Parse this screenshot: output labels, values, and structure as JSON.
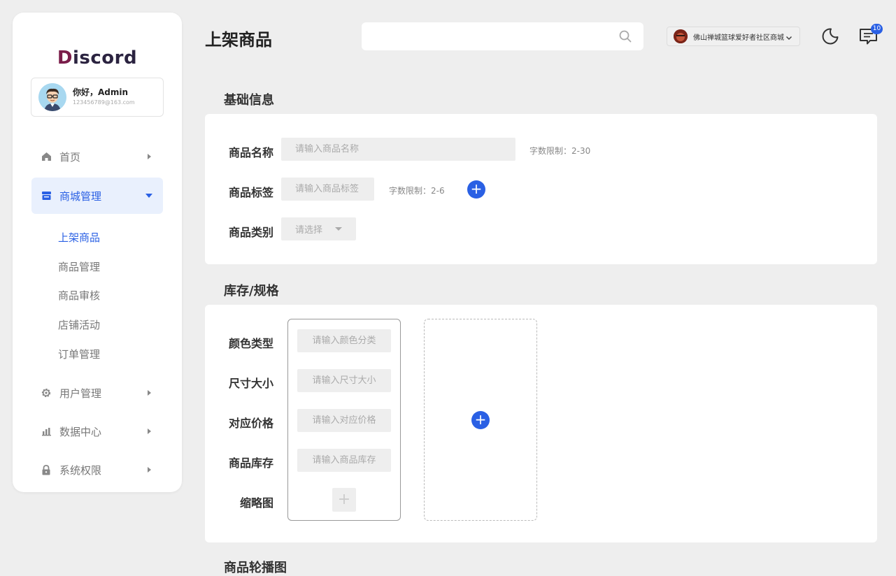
{
  "brand": {
    "logo_first": "D",
    "logo_rest": "iscord"
  },
  "user": {
    "greeting": "你好，Admin",
    "email": "123456789@163.com"
  },
  "sidebar": {
    "items": [
      {
        "label": "首页",
        "icon": "home-icon"
      },
      {
        "label": "商城管理",
        "icon": "store-icon"
      },
      {
        "label": "用户管理",
        "icon": "gear-icon"
      },
      {
        "label": "数据中心",
        "icon": "bar-chart-icon"
      },
      {
        "label": "系统权限",
        "icon": "lock-icon"
      }
    ],
    "sub_items": [
      "上架商品",
      "商品管理",
      "商品审核",
      "店铺活动",
      "订单管理"
    ]
  },
  "header": {
    "title": "上架商品",
    "search_placeholder": "",
    "shop_name": "佛山禅城篮球爱好者社区商城",
    "message_count": "10"
  },
  "basic_info": {
    "title": "基础信息",
    "name_label": "商品名称",
    "name_placeholder": "请输入商品名称",
    "name_hint": "字数限制：2-30",
    "tag_label": "商品标签",
    "tag_placeholder": "请输入商品标签",
    "tag_hint": "字数限制：2-6",
    "category_label": "商品类别",
    "category_value": "请选择"
  },
  "stock": {
    "title": "库存/规格",
    "color_label": "颜色类型",
    "color_placeholder": "请输入颜色分类",
    "size_label": "尺寸大小",
    "size_placeholder": "请输入尺寸大小",
    "price_label": "对应价格",
    "price_placeholder": "请输入对应价格",
    "qty_label": "商品库存",
    "qty_placeholder": "请输入商品库存",
    "thumb_label": "缩略图"
  },
  "carousel": {
    "title": "商品轮播图"
  },
  "colors": {
    "accent": "#2a60e4",
    "background": "#eeeeee"
  }
}
